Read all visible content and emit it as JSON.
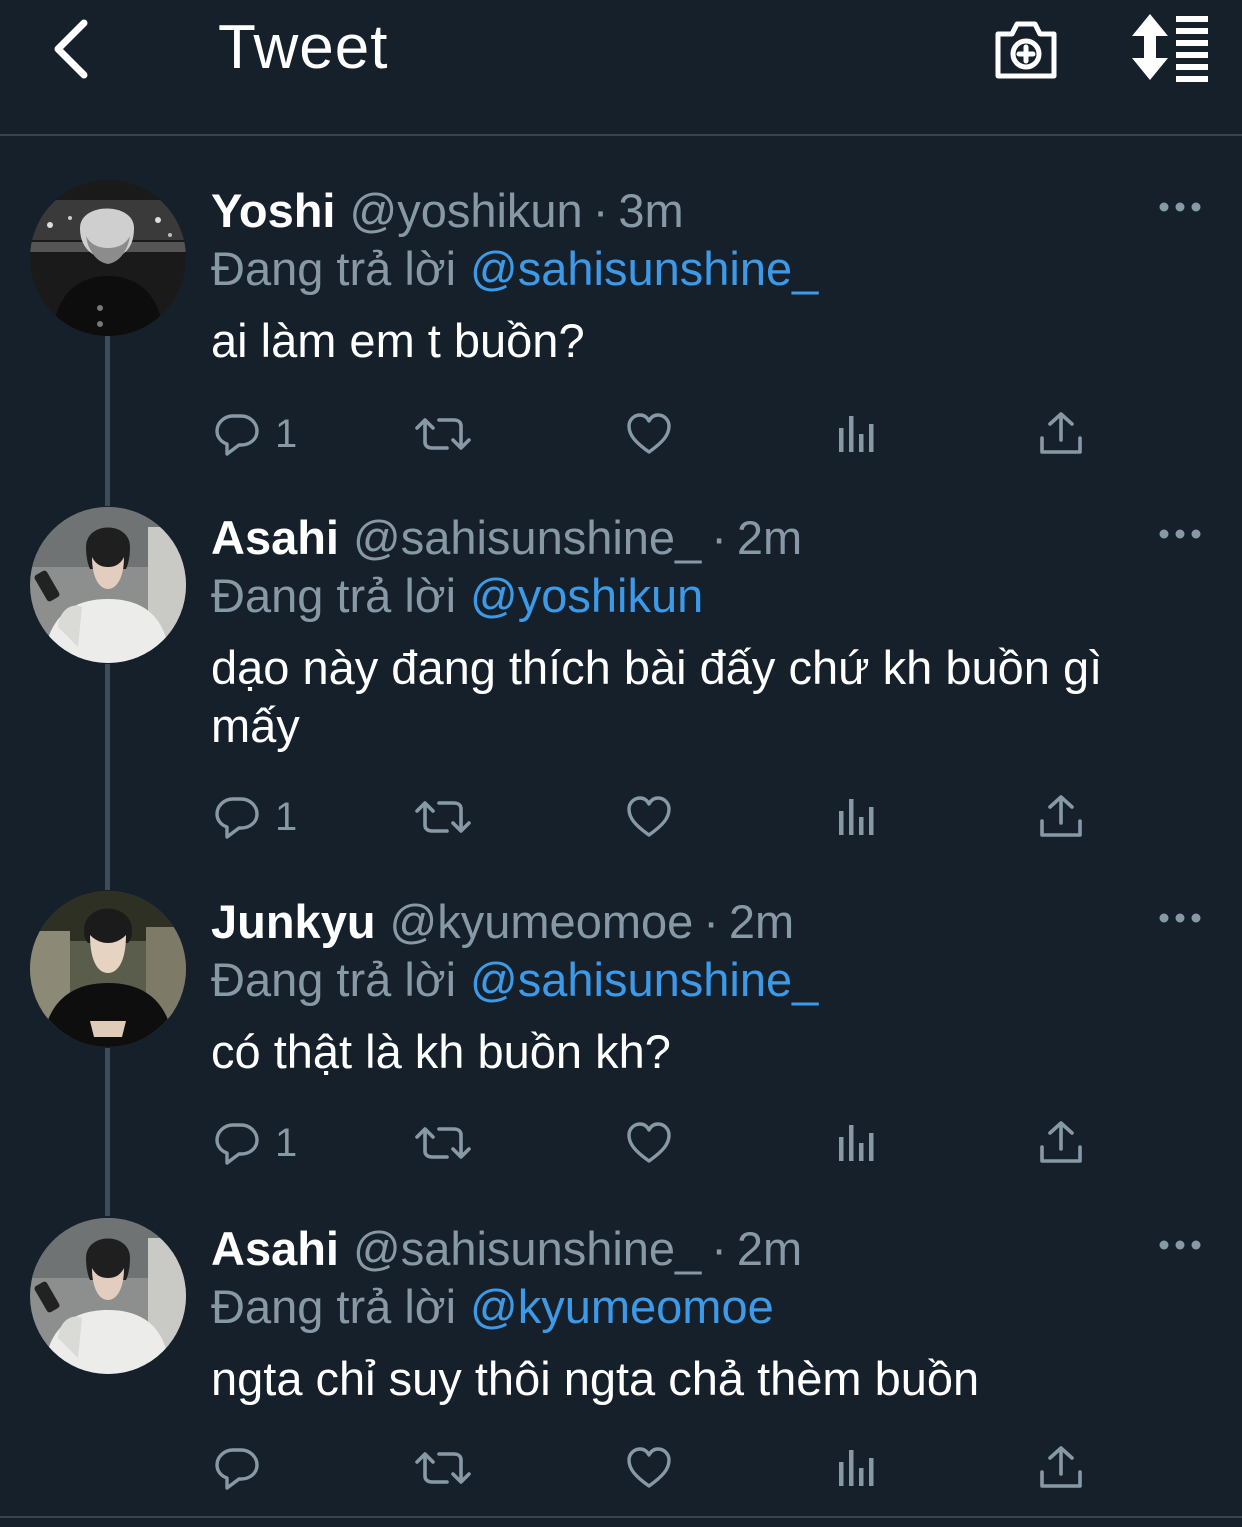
{
  "header": {
    "title": "Tweet",
    "back_icon": "chevron-left-icon",
    "camera_icon": "camera-plus-icon",
    "sort_icon": "sort-list-icon"
  },
  "colors": {
    "background": "#15202b",
    "secondary_text": "#8899a6",
    "mention": "#3d9ae8",
    "divider": "#38444d"
  },
  "tweets": [
    {
      "name": "Yoshi",
      "handle": "@yoshikun",
      "time": "3m",
      "reply_label": "Đang trả lời",
      "reply_to": "@sahisunshine_",
      "text": "ai làm em t buồn?",
      "reply_count": "1"
    },
    {
      "name": "Asahi",
      "handle": "@sahisunshine_",
      "time": "2m",
      "reply_label": "Đang trả lời",
      "reply_to": "@yoshikun",
      "text": "dạo này đang thích bài đấy chứ kh buồn gì mấy",
      "reply_count": "1"
    },
    {
      "name": "Junkyu",
      "handle": "@kyumeomoe",
      "time": "2m",
      "reply_label": "Đang trả lời",
      "reply_to": "@sahisunshine_",
      "text": "có thật là kh buồn kh?",
      "reply_count": "1"
    },
    {
      "name": "Asahi",
      "handle": "@sahisunshine_",
      "time": "2m",
      "reply_label": "Đang trả lời",
      "reply_to": "@kyumeomoe",
      "text": "ngta chỉ suy thôi ngta chả thèm buồn",
      "reply_count": ""
    }
  ]
}
